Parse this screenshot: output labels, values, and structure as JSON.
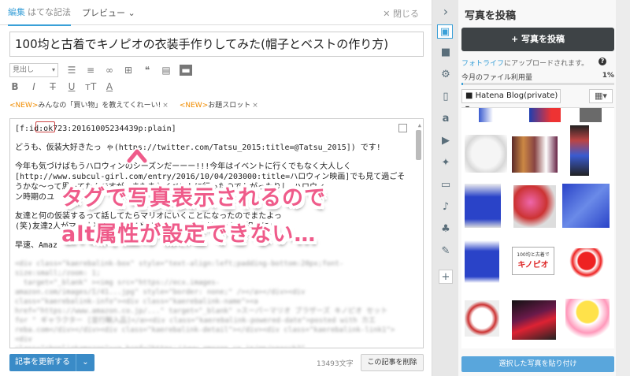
{
  "tabs": {
    "edit_label": "編集",
    "edit_mode": "はてな記法",
    "preview_label": "プレビュー ⌄",
    "close_label": "✕ 閉じる"
  },
  "title": "100均と古着でキノピオの衣装手作りしてみた(帽子とベストの作り方)",
  "toolbar": {
    "heading_select": "見出し"
  },
  "slots": [
    {
      "new": "<NEW>",
      "text": "みんなの「買い物」を教えてくれーい!",
      "close": "×"
    },
    {
      "new": "<NEW>",
      "text": "お題スロット",
      "close": "×"
    }
  ],
  "body": {
    "line1": "[f:id:ok723:20161005234439p:plain]",
    "para1": "どうも、仮装大好きたっ ゃ(https://twitter.com/Tatsu_2015:title=@Tatsu_2015]) です!",
    "para2": "今年も気づけばもうハロウィンのシーズンだーーー!!!今年はイベントに行くでもなく大人しく\n[http://www.subcul-girl.com/entry/2016/10/04/203000:title=ハロウィン映画]でも見て過ごそ\nうかな〜って思ってたんですが、またまたイベントに行ったのでトがったりし ハロウィ\nン時期のユ",
    "para3": "友達と何の仮装するって話してたらマリオにいくことになったのでまたよっ\n(笑)友達2人がマリオとルイージをやりた たので、私はキノピオ担当に!",
    "para4": "早速、Amaz",
    "blurred": "<div class=\"kaerebalink-box\" style=\"text-align:left;padding-bottom:20px;font-size:small;/zoom: 1;\n  target=\"_blank\" ><img src=\"https://ecx.images-\namazon.com/images/I/41...jpg\" style=\"border: none;\" /></a></div><div\nclass=\"kaerebalink-info\"><div class=\"kaerebalink-name\"><a\nhref=\"https://www.amazon.co.jp/...\" target=\"_blank\" >スーパーマリオ ブラザーズ キノピオ セット\nfor \" ギャラクター [並行輸入品]</a><div class=\"kaerebalink-powered-date\">posted with カエ\nreba.com</div></div><div class=\"kaerebalink-detail\"></div><div class=\"kaerebalink-link1\"><div\nclass=\"shoplinkamazon\"><a href=\"https://www.amazon.co.jp/gp/search?\"\n target=\"_blank\" >Amazon</a></div></div></div>"
  },
  "annotation": {
    "line1": "タグで写真表示されるので",
    "line2": "alt属性が設定できない…"
  },
  "bottom": {
    "update_label": "記事を更新する",
    "char_count": "13493文字",
    "delete_label": "この記事を削除"
  },
  "panel": {
    "title": "写真を投稿",
    "post_button": "+ 写真を投稿",
    "fotolife_link": "フォトライフ",
    "fotolife_text": "にアップロードされます。",
    "usage_label": "今月のファイル利用量",
    "usage_pct": "1%",
    "usage_fraction": 0.01,
    "folder": "Hatena Blog(private) ▾",
    "paste_button": "選択した写真を貼り付け"
  },
  "colors": {
    "accent": "#3aa0d8",
    "annotation": "#ef5b8a",
    "dark_button": "#3e4346",
    "new_tag": "#f08c00"
  },
  "sidebar_icons": [
    "chevron-right-icon",
    "photo-icon",
    "folder-icon",
    "gear-icon",
    "document-icon",
    "amazon-icon",
    "youtube-icon",
    "twitter-icon",
    "tv-icon",
    "music-icon",
    "evernote-icon",
    "brush-icon",
    "plus-icon"
  ],
  "thumb_labels": {
    "kinopio_card": "100均と古着で",
    "kinopio_sub": "キノピオ"
  }
}
